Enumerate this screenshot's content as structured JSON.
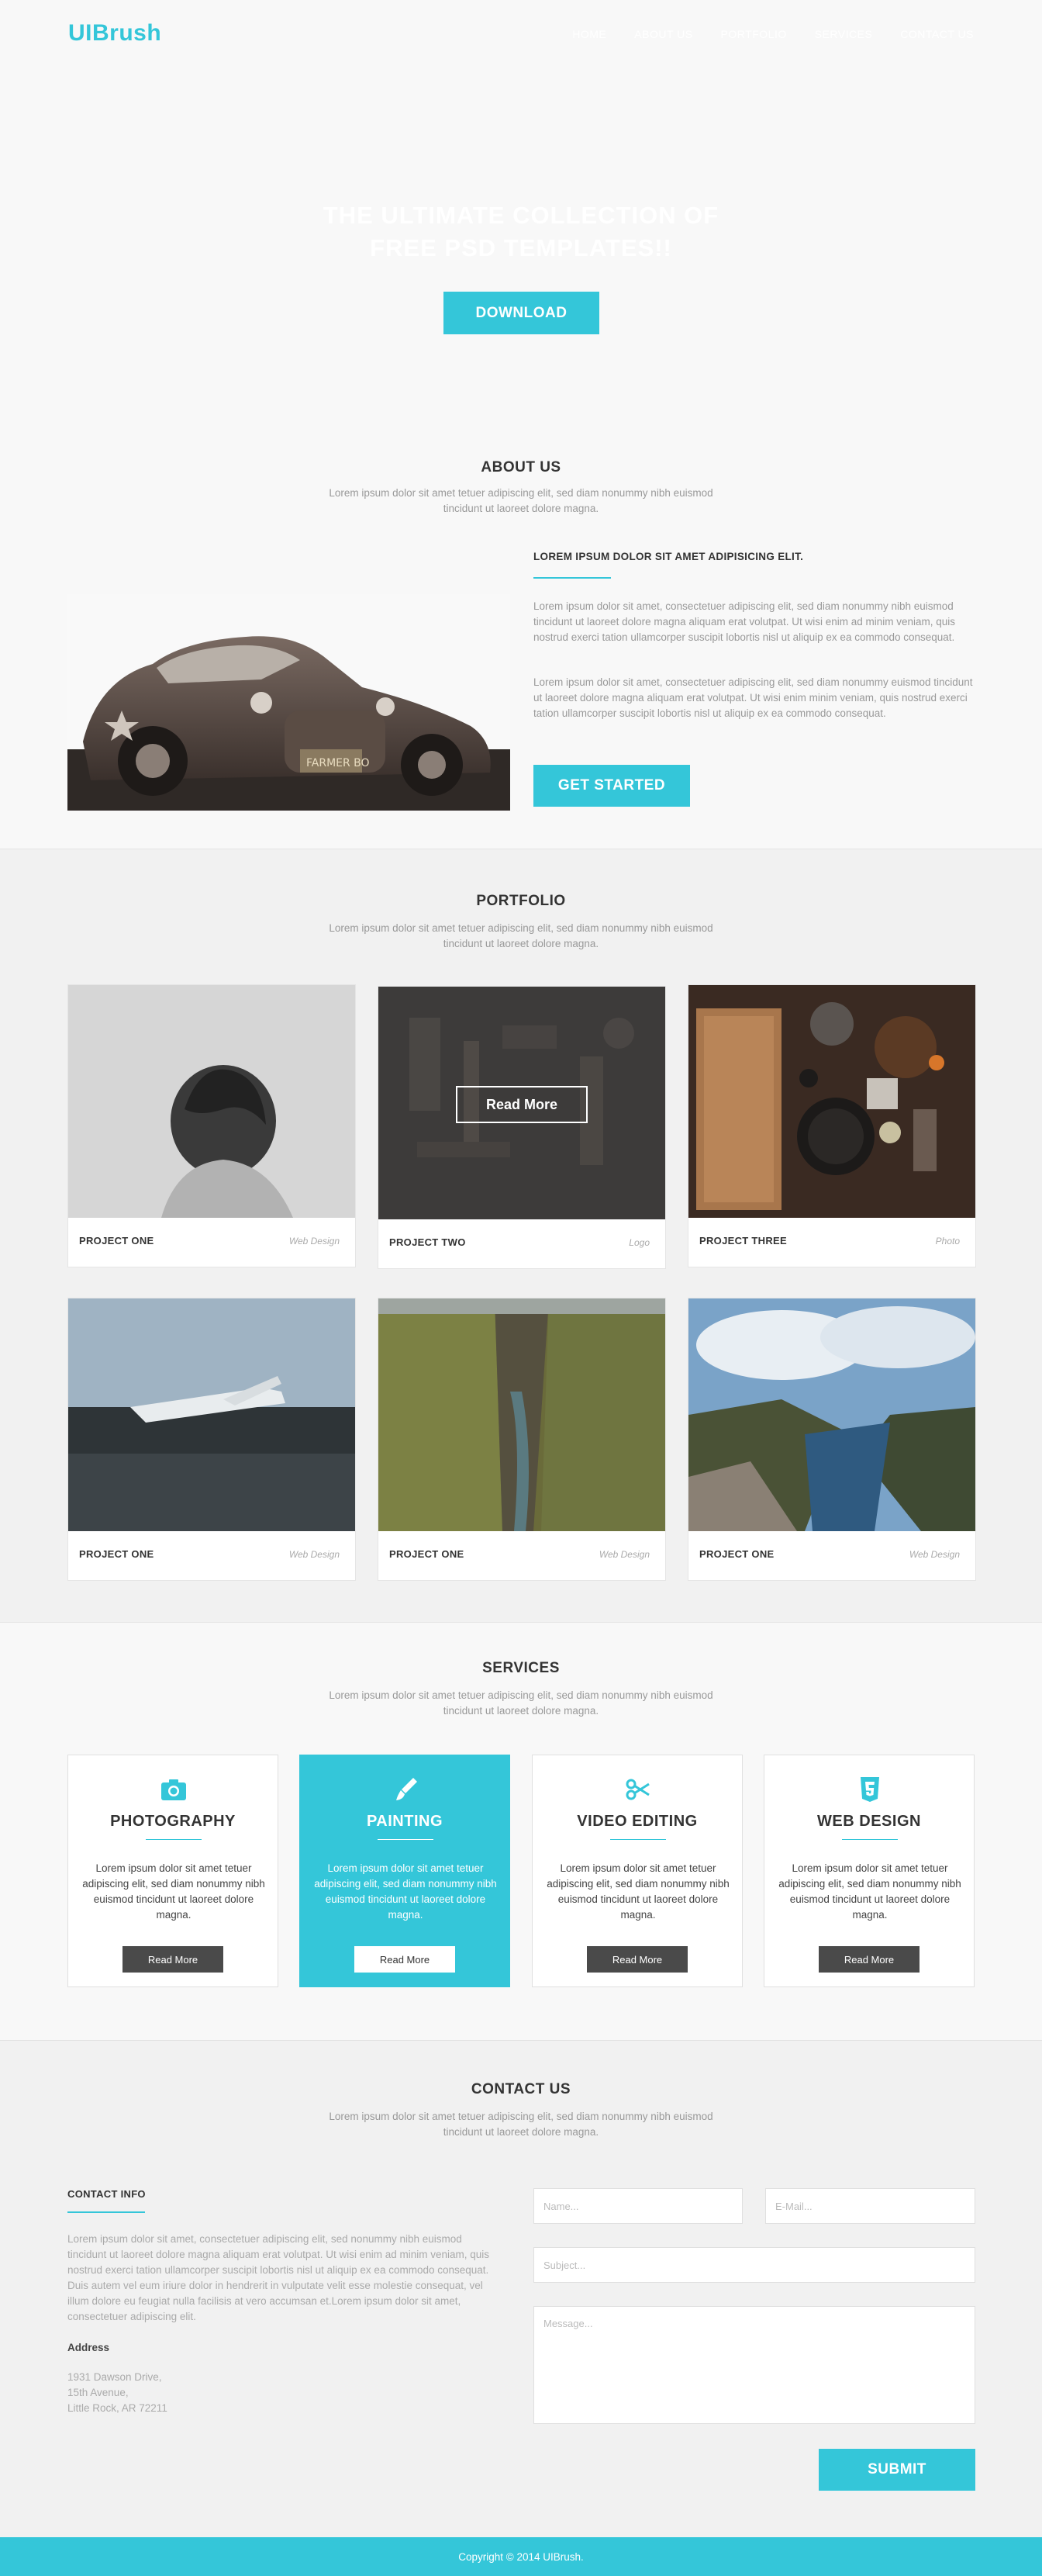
{
  "header": {
    "logo": "UIBrush",
    "nav": [
      "HOME",
      "ABOUT US",
      "PORTFOLIO",
      "SERVICES",
      "CONTACT US"
    ]
  },
  "hero": {
    "title_line1": "THE ULTIMATE COLLECTION OF",
    "title_line2": "FREE PSD TEMPLATES!!",
    "download_label": "DOWNLOAD"
  },
  "about": {
    "title": "ABOUT US",
    "subtitle": "Lorem ipsum dolor sit amet tetuer adipiscing elit, sed diam nonummy nibh euismod tincidunt ut laoreet dolore magna.",
    "heading": "LOREM IPSUM DOLOR SIT AMET ADIPISICING ELIT.",
    "para1": "Lorem ipsum dolor sit amet, consectetuer adipiscing elit, sed diam nonummy nibh euismod tincidunt ut laoreet dolore magna aliquam erat volutpat. Ut wisi enim ad minim veniam, quis nostrud exerci tation ullamcorper suscipit lobortis nisl ut aliquip ex ea commodo consequat.",
    "para2": "Lorem ipsum dolor sit amet, consectetuer adipiscing elit, sed diam nonummy euismod tincidunt ut laoreet dolore magna aliquam erat volutpat. Ut wisi enim minim veniam, quis nostrud exerci tation ullamcorper suscipit lobortis nisl ut aliquip ex ea commodo consequat.",
    "cta_label": "GET STARTED"
  },
  "portfolio": {
    "title": "PORTFOLIO",
    "subtitle": "Lorem ipsum dolor sit amet tetuer adipiscing elit, sed diam nonummy nibh euismod tincidunt ut laoreet dolore magna.",
    "overlay_label": "Read More",
    "items": [
      {
        "name": "PROJECT ONE",
        "tag": "Web Design"
      },
      {
        "name": "PROJECT TWO",
        "tag": "Logo"
      },
      {
        "name": "PROJECT THREE",
        "tag": "Photo"
      },
      {
        "name": "PROJECT ONE",
        "tag": "Web Design"
      },
      {
        "name": "PROJECT ONE",
        "tag": "Web Design"
      },
      {
        "name": "PROJECT ONE",
        "tag": "Web Design"
      }
    ]
  },
  "services": {
    "title": "SERVICES",
    "subtitle": "Lorem ipsum dolor sit amet tetuer adipiscing elit, sed diam nonummy nibh euismod tincidunt ut laoreet dolore magna.",
    "items": [
      {
        "name": "PHOTOGRAPHY",
        "icon": "camera-icon",
        "desc": "Lorem ipsum dolor sit amet tetuer adipiscing elit, sed diam nonummy nibh euismod tincidunt ut laoreet dolore magna.",
        "button": "Read More"
      },
      {
        "name": "PAINTING",
        "icon": "paintbrush-icon",
        "desc": "Lorem ipsum dolor sit amet tetuer adipiscing elit, sed diam nonummy nibh euismod tincidunt ut laoreet dolore magna.",
        "button": "Read More"
      },
      {
        "name": "VIDEO EDITING",
        "icon": "scissors-icon",
        "desc": "Lorem ipsum dolor sit amet tetuer adipiscing elit, sed diam nonummy nibh euismod tincidunt ut laoreet dolore magna.",
        "button": "Read More"
      },
      {
        "name": "WEB DESIGN",
        "icon": "html5-icon",
        "desc": "Lorem ipsum dolor sit amet tetuer adipiscing elit, sed diam nonummy nibh euismod tincidunt ut laoreet dolore magna.",
        "button": "Read More"
      }
    ]
  },
  "contact": {
    "title": "CONTACT US",
    "subtitle": "Lorem ipsum dolor sit amet tetuer adipiscing elit, sed diam nonummy nibh euismod tincidunt ut laoreet dolore magna.",
    "info_heading": "CONTACT INFO",
    "info_text": "Lorem ipsum dolor sit amet, consectetuer adipiscing elit, sed nonummy nibh euismod tincidunt ut laoreet dolore magna aliquam erat volutpat. Ut wisi enim ad minim veniam, quis nostrud exerci tation ullamcorper suscipit lobortis nisl ut aliquip ex ea commodo consequat. Duis autem vel eum iriure dolor in hendrerit in vulputate velit esse molestie consequat, vel illum dolore eu feugiat nulla facilisis at vero accumsan et.Lorem ipsum dolor sit amet, consectetuer adipiscing elit.",
    "address_heading": "Address",
    "address_lines": [
      "1931 Dawson Drive,",
      "15th Avenue,",
      "Little Rock, AR 72211"
    ],
    "form": {
      "name_placeholder": "Name...",
      "email_placeholder": "E-Mail...",
      "subject_placeholder": "Subject...",
      "message_placeholder": "Message...",
      "submit_label": "SUBMIT"
    }
  },
  "footer": {
    "copyright": "Copyright © 2014 UIBrush."
  },
  "colors": {
    "accent": "#34c6d9",
    "dark_button": "#4a4a4a",
    "heading": "#333333",
    "muted_text": "#999999"
  }
}
